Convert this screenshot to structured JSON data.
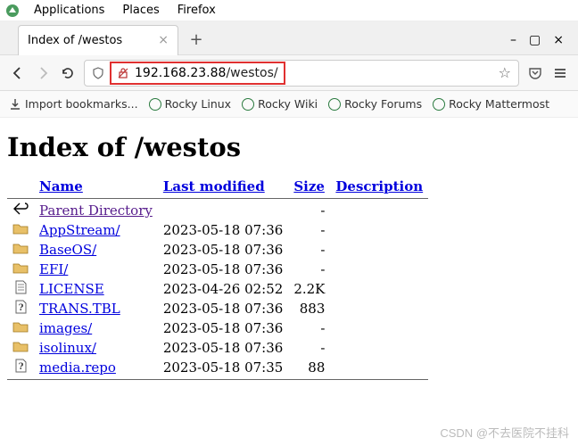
{
  "menubar": {
    "items": [
      "Applications",
      "Places",
      "Firefox"
    ]
  },
  "tab": {
    "title": "Index of /westos",
    "new": "+"
  },
  "window": {
    "min": "–",
    "max": "▢",
    "close": "×"
  },
  "nav": {
    "back": "←",
    "forward": "→",
    "reload": "⟳"
  },
  "url": {
    "shield": "▽",
    "lock": "⊘",
    "ip": "192.168.23.88",
    "path": "/westos/",
    "star": "☆",
    "pocket": "⌵",
    "menu": "≡"
  },
  "bookmarks": {
    "import": "Import bookmarks...",
    "items": [
      "Rocky Linux",
      "Rocky Wiki",
      "Rocky Forums",
      "Rocky Mattermost"
    ]
  },
  "page": {
    "heading": "Index of /westos",
    "cols": {
      "name": "Name",
      "lastmod": "Last modified",
      "size": "Size",
      "desc": "Description"
    },
    "rows": [
      {
        "icon": "back",
        "name": "Parent Directory",
        "date": "",
        "size": "-",
        "visited": true
      },
      {
        "icon": "folder",
        "name": "AppStream/",
        "date": "2023-05-18 07:36",
        "size": "-"
      },
      {
        "icon": "folder",
        "name": "BaseOS/",
        "date": "2023-05-18 07:36",
        "size": "-"
      },
      {
        "icon": "folder",
        "name": "EFI/",
        "date": "2023-05-18 07:36",
        "size": "-"
      },
      {
        "icon": "file",
        "name": "LICENSE",
        "date": "2023-04-26 02:52",
        "size": "2.2K"
      },
      {
        "icon": "unknown",
        "name": "TRANS.TBL",
        "date": "2023-05-18 07:36",
        "size": "883"
      },
      {
        "icon": "folder",
        "name": "images/",
        "date": "2023-05-18 07:36",
        "size": "-"
      },
      {
        "icon": "folder",
        "name": "isolinux/",
        "date": "2023-05-18 07:36",
        "size": "-"
      },
      {
        "icon": "unknown",
        "name": "media.repo",
        "date": "2023-05-18 07:35",
        "size": "88"
      }
    ]
  },
  "watermark": "CSDN @不去医院不挂科"
}
